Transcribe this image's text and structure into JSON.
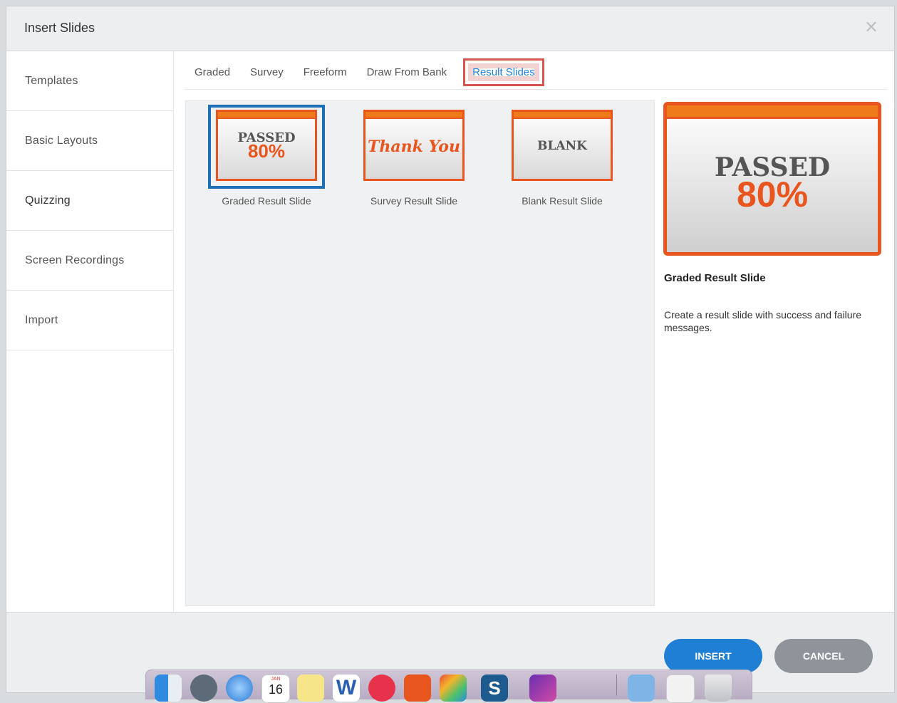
{
  "dialog": {
    "title": "Insert Slides",
    "close_symbol": "×"
  },
  "sidebar": {
    "items": [
      {
        "label": "Templates"
      },
      {
        "label": "Basic Layouts"
      },
      {
        "label": "Quizzing",
        "active": true
      },
      {
        "label": "Screen Recordings"
      },
      {
        "label": "Import"
      }
    ]
  },
  "tabs": [
    {
      "label": "Graded"
    },
    {
      "label": "Survey"
    },
    {
      "label": "Freeform"
    },
    {
      "label": "Draw From Bank"
    },
    {
      "label": "Result Slides",
      "active": true
    }
  ],
  "gallery": {
    "thumbnails": [
      {
        "caption": "Graded Result Slide",
        "line1": "PASSED",
        "line2": "80%",
        "selected": true
      },
      {
        "caption": "Survey Result Slide",
        "line1": "Thank You"
      },
      {
        "caption": "Blank Result Slide",
        "line1": "BLANK"
      }
    ]
  },
  "preview": {
    "line1": "PASSED",
    "line2": "80%",
    "title": "Graded Result Slide",
    "description": "Create a result slide with success and failure messages."
  },
  "footer": {
    "insert_label": "INSERT",
    "cancel_label": "CANCEL"
  },
  "colors": {
    "accent": "#1e7fd4",
    "slide_orange": "#e8551e",
    "highlight_red": "#d9534f"
  },
  "dock": {
    "icons": [
      "finder-icon",
      "launchpad-icon",
      "safari-icon",
      "calendar-icon",
      "notes-icon",
      "word-icon",
      "music-icon",
      "app-icon",
      "app-icon",
      "snagit-icon",
      "app-icon",
      "folder-icon",
      "preview-icon",
      "trash-icon"
    ],
    "calendar_month": "JAN",
    "calendar_day": "16",
    "word_letter": "W",
    "snagit_letter": "S"
  }
}
